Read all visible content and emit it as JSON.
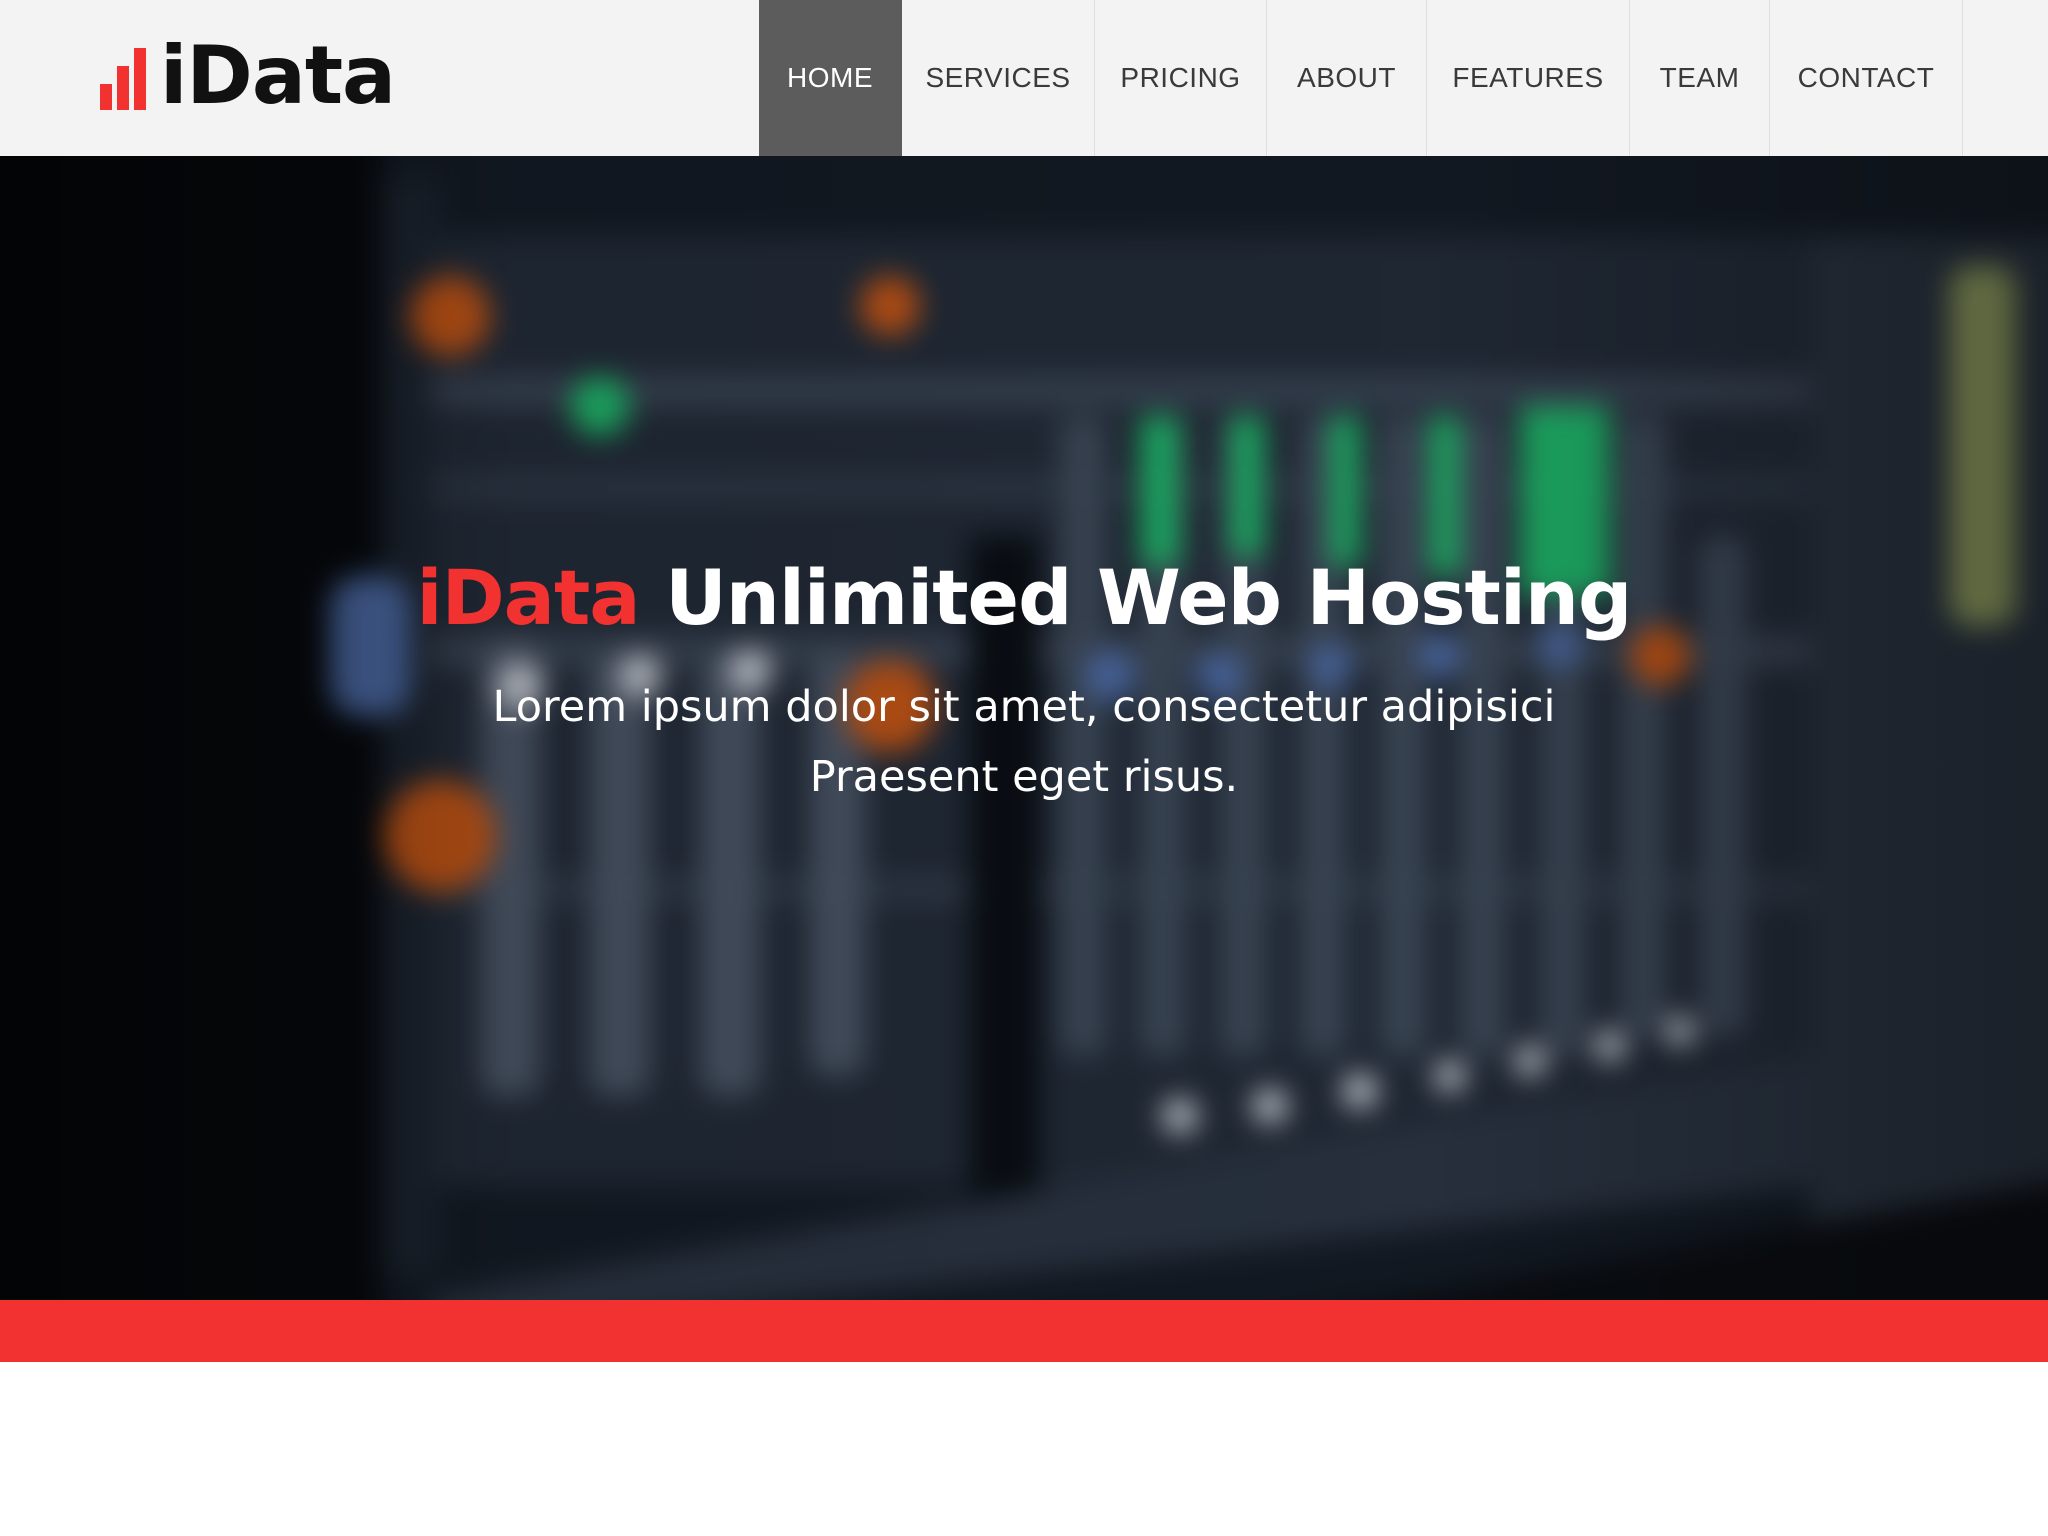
{
  "brand": {
    "logo_text": "iData",
    "logo_icon": "bar-chart-icon",
    "accent_color": "#f23131"
  },
  "nav": {
    "items": [
      {
        "label": "HOME",
        "active": true
      },
      {
        "label": "SERVICES",
        "active": false
      },
      {
        "label": "PRICING",
        "active": false
      },
      {
        "label": "ABOUT",
        "active": false
      },
      {
        "label": "FEATURES",
        "active": false
      },
      {
        "label": "TEAM",
        "active": false
      },
      {
        "label": "CONTACT",
        "active": false
      }
    ]
  },
  "hero": {
    "title_brand": "iData",
    "title_rest": "Unlimited Web Hosting",
    "subtitle_line1": "Lorem ipsum dolor sit amet, consectetur adipisici",
    "subtitle_line2": "Praesent eget risus."
  }
}
